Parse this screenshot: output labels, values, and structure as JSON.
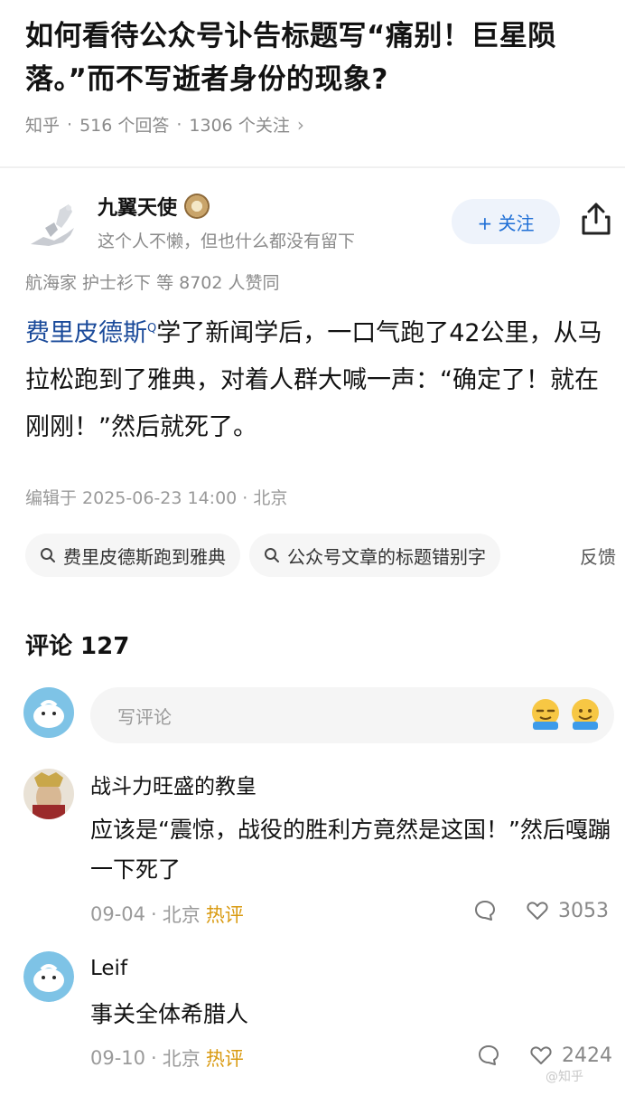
{
  "question": {
    "title": "如何看待公众号讣告标题写“痛别！巨星陨落。”而不写逝者身份的现象?",
    "source": "知乎",
    "sep": "·",
    "answers": "516 个回答",
    "followers": "1306 个关注",
    "chevron": "›"
  },
  "answer": {
    "author_name": "九翼天使",
    "author_bio": "这个人不懒，但也什么都没有留下",
    "follow_label": "+ 关注",
    "endorsement": "航海家 护士衫下 等 8702 人赞同",
    "link_text": "费里皮德斯",
    "link_mark": "Q",
    "body_rest": "学了新闻学后，一口气跑了42公里，从马拉松跑到了雅典，对着人群大喊一声：“确定了！就在刚刚！”然后就死了。",
    "edit_meta": "编辑于 2025-06-23 14:00 · 北京",
    "tags": [
      {
        "label": "费里皮德斯跑到雅典"
      },
      {
        "label": "公众号文章的标题错别字"
      }
    ],
    "feedback": "反馈"
  },
  "comments": {
    "title": "评论 127",
    "input_placeholder": "写评论",
    "items": [
      {
        "name": "战斗力旺盛的教皇",
        "text": "应该是“震惊，战役的胜利方竟然是这国！”然后嘎蹦一下死了",
        "date": "09-04",
        "location": "北京",
        "badge": "热评",
        "likes": "3053"
      },
      {
        "name": "Leif",
        "text": "事关全体希腊人",
        "date": "09-10",
        "location": "北京",
        "badge": "热评",
        "likes": "2424"
      }
    ]
  },
  "watermark": "@知乎",
  "colors": {
    "accent": "#1f6fd6",
    "link": "#1a4a9a",
    "hot": "#d99a10",
    "muted": "#8a8a8a"
  },
  "icons": {
    "share": "share-icon",
    "search": "search-icon",
    "comment": "comment-bubble-icon",
    "like": "heart-icon"
  }
}
